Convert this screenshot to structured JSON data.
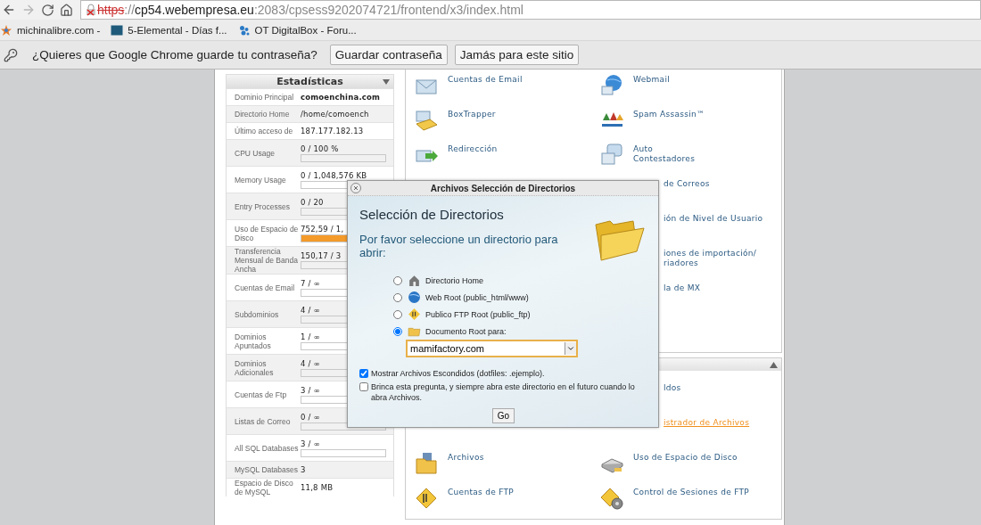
{
  "browser": {
    "forward_disabled": true,
    "url": [
      {
        "kind": "insecure-scheme",
        "text": "https"
      },
      {
        "kind": "separator",
        "text": "://"
      },
      {
        "kind": "host",
        "text": "cp54.webempresa.eu"
      },
      {
        "kind": "path",
        "text": ":2083/cpsess9202074721/frontend/x3/index.html"
      }
    ],
    "bookmarks": [
      {
        "label": "michinalibre.com -"
      },
      {
        "label": "5-Elemental - Días f..."
      },
      {
        "label": "OT DigitalBox - Foru..."
      }
    ],
    "infobar": {
      "message": "¿Quieres que Google Chrome guarde tu contraseña?",
      "buttons": [
        "Guardar contraseña",
        "Jamás para este sitio"
      ]
    }
  },
  "stats": {
    "title": "Estadísticas",
    "rows": [
      {
        "kind": "primary",
        "label": "Dominio Principal",
        "value": "comoenchina.com"
      },
      {
        "kind": "text",
        "label": "Directorio Home",
        "value": "/home/comoench"
      },
      {
        "kind": "text",
        "label": "Último acceso de",
        "value": "187.177.182.13"
      },
      {
        "kind": "meter",
        "label": "CPU Usage",
        "value": "0 / 100 %"
      },
      {
        "kind": "meter",
        "label": "Memory Usage",
        "value": "0 / 1,048,576 KB"
      },
      {
        "kind": "meter",
        "label": "Entry Processes",
        "value": "0 / 20"
      },
      {
        "kind": "meter",
        "label": "Uso de Espacio de Disco",
        "value": "752,59 / 1,",
        "level": 0.75
      },
      {
        "kind": "meter",
        "label": "Transferencia Mensual de Banda Ancha",
        "value": "150,17 / 3"
      },
      {
        "kind": "meter",
        "label": "Cuentas de Email",
        "value": "7 / ∞"
      },
      {
        "kind": "meter",
        "label": "Subdominios",
        "value": "4 / ∞"
      },
      {
        "kind": "meter",
        "label": "Dominios Apuntados",
        "value": "1 / ∞"
      },
      {
        "kind": "meter",
        "label": "Dominios Adicionales",
        "value": "4 / ∞"
      },
      {
        "kind": "meter",
        "label": "Cuentas de Ftp",
        "value": "3 / ∞"
      },
      {
        "kind": "meter",
        "label": "Listas de Correo",
        "value": "0 / ∞"
      },
      {
        "kind": "meter",
        "label": "All SQL Databases",
        "value": "3 / ∞"
      },
      {
        "kind": "text",
        "label": "MySQL Databases",
        "value": "3"
      },
      {
        "kind": "text",
        "label": "Espacio de Disco de MySQL",
        "value": "11,8 MB"
      }
    ]
  },
  "panels": [
    {
      "header": false,
      "rows": [
        {
          "left": {
            "kind": "normal",
            "label": "Cuentas de Email",
            "highlighted": false
          },
          "right": {
            "kind": "normal",
            "label": "Webmail",
            "highlighted": false
          }
        },
        {
          "left": {
            "kind": "normal",
            "label": "BoxTrapper",
            "highlighted": false
          },
          "right": {
            "kind": "normal",
            "label": "Spam Assassin™",
            "highlighted": false
          }
        },
        {
          "left": {
            "kind": "normal",
            "label": "Redirección",
            "highlighted": false
          },
          "right": {
            "kind": "normal",
            "label": "Auto\nContestadores",
            "highlighted": false
          }
        },
        {
          "right": {
            "kind": "clipped",
            "label": "de Correos",
            "highlighted": false
          }
        },
        {
          "right": {
            "kind": "clipped",
            "label": "ión de Nivel de Usuario",
            "highlighted": false
          }
        },
        {
          "right": {
            "kind": "clipped",
            "label": "iones de importación/\nriadores",
            "highlighted": false
          }
        },
        {
          "right": {
            "kind": "clipped",
            "label": "la de MX",
            "highlighted": false
          }
        }
      ]
    },
    {
      "header": true,
      "rows": [
        {
          "right": {
            "kind": "clipped",
            "label": "ldos",
            "highlighted": false
          }
        },
        {
          "right": {
            "kind": "clipped",
            "label": "istrador de Archivos",
            "highlighted": true
          }
        },
        {
          "left": {
            "kind": "normal",
            "label": "Archivos",
            "highlighted": false
          },
          "right": {
            "kind": "normal",
            "label": "Uso de Espacio de Disco",
            "highlighted": false
          }
        },
        {
          "left": {
            "kind": "normal",
            "label": "Cuentas de FTP",
            "highlighted": false
          },
          "right": {
            "kind": "normal",
            "label": "Control de Sesiones de FTP",
            "highlighted": false
          }
        }
      ]
    }
  ],
  "dialog": {
    "title": "Archivos Selección de Directorios",
    "heading": "Selección de Directorios",
    "prompt": "Por favor seleccione un directorio para abrir:",
    "options": [
      {
        "label": "Directorio Home",
        "selected": false
      },
      {
        "label": "Web Root (public_html/www)",
        "selected": false
      },
      {
        "label": "Publico FTP Root (public_ftp)",
        "selected": false
      },
      {
        "label": "Documento Root para:",
        "selected": true
      }
    ],
    "domain": "mamifactory.com",
    "checkboxes": [
      {
        "label": "Mostrar Archivos Escondidos (dotfiles: .ejemplo).",
        "checked": true
      },
      {
        "label": "Brinca esta pregunta, y siempre abra este directorio en el futuro cuando lo abra Archivos.",
        "checked": false
      }
    ],
    "button": "Go"
  }
}
